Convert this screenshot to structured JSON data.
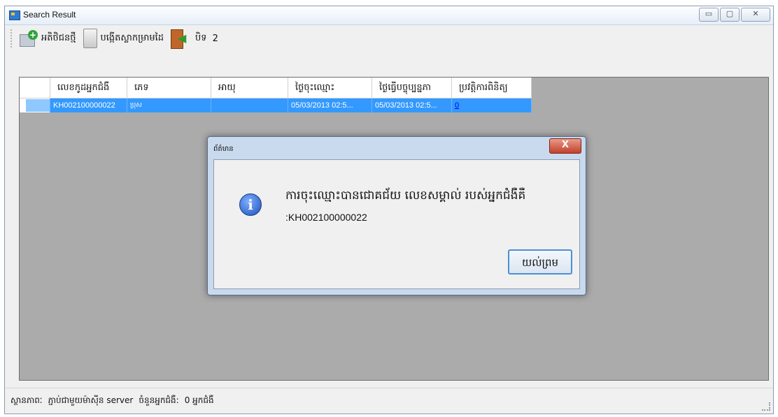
{
  "window": {
    "title": "Search Result",
    "controls": {
      "minimize": "▭",
      "maximize": "▢",
      "close": "✕"
    }
  },
  "toolbar": {
    "new_patient": "អតិថិជនថ្មី",
    "create_form": "បង្កើតស្លាកម្រាមដៃ",
    "close": "បិទ",
    "extra": "2"
  },
  "grid": {
    "columns": [
      "លេខកូដអ្នកជំងឺ",
      "ភេទ",
      "អាយុ",
      "ថ្ងៃចុះឈ្មោះ",
      "ថ្ងៃធ្វើបច្ចុប្បន្នភា",
      "ប្រវត្តិការពិនិត្យ"
    ],
    "rows": [
      {
        "code": "KH002100000022",
        "sex": "ប្រុស",
        "age": "",
        "registered": "05/03/2013 02:5...",
        "updated": "05/03/2013 02:5...",
        "history": "0"
      }
    ]
  },
  "status": {
    "state_label": "ស្ថានភាពៈ",
    "state_value": "ភ្ជាប់ជាមួយម៉ាស៊ីន server",
    "count_label": "ចំនួនអ្នកជំងឺ:",
    "count_value": "0 អ្នកជំងឺ"
  },
  "dialog": {
    "title": "ព័ត៌មាន",
    "close": "X",
    "message_line1": "ការចុះឈ្មោះបានជោគជ័យ លេខសម្គាល់ របស់អ្នកជំងឺគឺ",
    "message_line2": ":KH002100000022",
    "ok_label": "យល់ព្រម"
  },
  "colors": {
    "selection": "#3399ff",
    "grid_background": "#ababab",
    "dialog_frame": "#c9daee"
  }
}
